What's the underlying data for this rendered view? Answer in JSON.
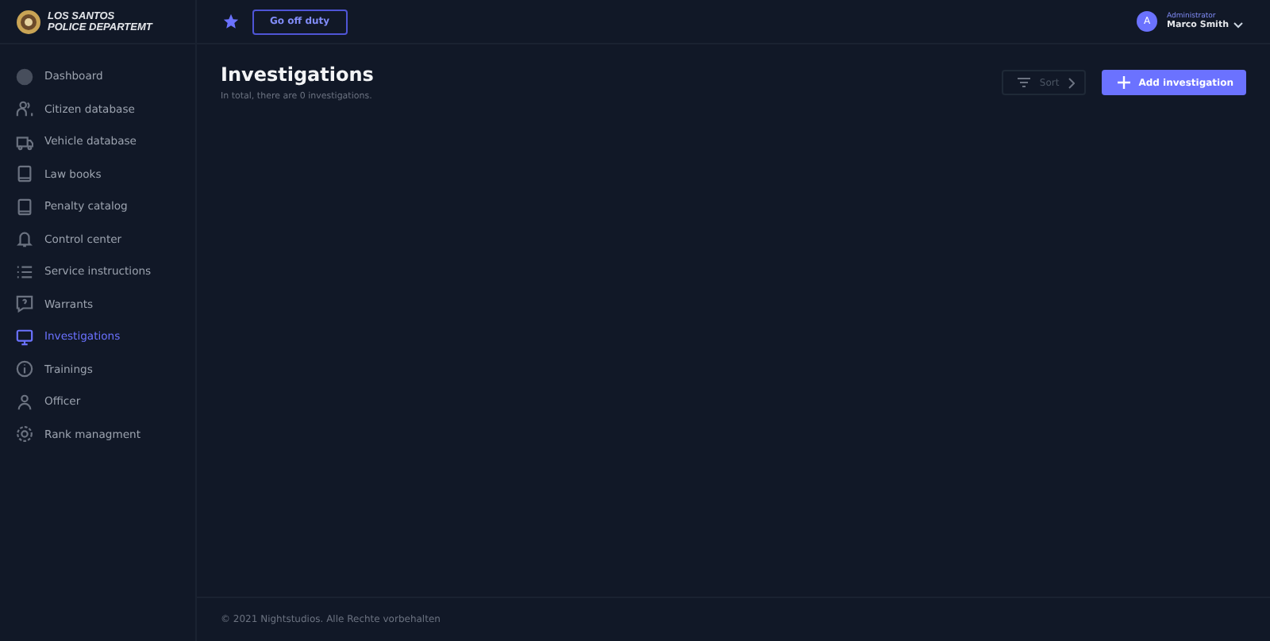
{
  "logo": {
    "line_1": "LOS SANTOS",
    "line_2": "POLICE DEPARTEMT"
  },
  "topbar": {
    "duty_button": "Go off duty",
    "user": {
      "initial": "A",
      "role": "Administrator",
      "name": "Marco Smith"
    }
  },
  "sidebar": {
    "items": [
      {
        "label": "Dashboard",
        "selected": false
      },
      {
        "label": "Citizen database",
        "selected": false
      },
      {
        "label": "Vehicle database",
        "selected": false
      },
      {
        "label": "Law books",
        "selected": false
      },
      {
        "label": "Penalty catalog",
        "selected": false
      },
      {
        "label": "Control center",
        "selected": false
      },
      {
        "label": "Service instructions",
        "selected": false
      },
      {
        "label": "Warrants",
        "selected": false
      },
      {
        "label": "Investigations",
        "selected": true
      },
      {
        "label": "Trainings",
        "selected": false
      },
      {
        "label": "Officer",
        "selected": false
      },
      {
        "label": "Rank managment",
        "selected": false
      }
    ]
  },
  "page": {
    "title": "Investigations",
    "subtitle": "In total, there are 0 investigations.",
    "sort_button": "Sort",
    "add_button": "Add investigation"
  },
  "footer": "© 2021 Nightstudios. Alle Rechte vorbehalten"
}
